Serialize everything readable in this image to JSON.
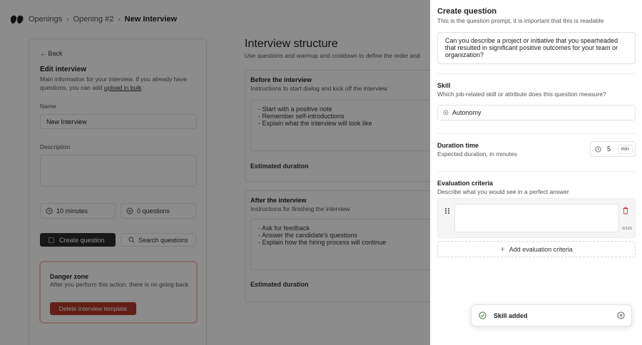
{
  "breadcrumb": [
    "Openings",
    "Opening #2",
    "New Interview"
  ],
  "edit": {
    "back_label": "Back",
    "title": "Edit interview",
    "desc_prefix": "Main information for your interview. If you already have questions, you can add ",
    "desc_link": "upload in bulk",
    "desc_suffix": ".",
    "name_label": "Name",
    "name_value": "New Interview",
    "description_label": "Description",
    "description_value": "",
    "duration_stat": "10 minutes",
    "questions_stat": "0 questions",
    "create_question": "Create question",
    "search_questions": "Search questions",
    "danger_title": "Danger zone",
    "danger_desc": "After you perform this action, there is no going back",
    "delete_template": "Delete interview template"
  },
  "structure": {
    "title": "Interview structure",
    "subtitle": "Use questions and warmup and cooldown to define the order and",
    "before": {
      "title": "Before the interview",
      "subtitle": "Instructions to start dialog and kick off the interview",
      "lines": [
        "- Start with a positive note",
        "- Remember self-introductions",
        "- Explain what the interview will look like"
      ],
      "estimated": "Estimated duration"
    },
    "after": {
      "title": "After the interview",
      "subtitle": "Instructions for finishing the interview",
      "lines": [
        "- Ask for feedback",
        "- Answer the candidate's questions",
        "- Explain how the hiring process will continue"
      ],
      "estimated": "Estimated duration"
    }
  },
  "drawer": {
    "title": "Create question",
    "subtitle": "This is the question prompt, it is important that this is readable",
    "question_text": "Can you describe a project or initiative that you spearheaded that resulted in significant positive outcomes for your team or organization?",
    "skill_label": "Skill",
    "skill_help": "Which job-related skill or attribute does this question measure?",
    "skill_value": "Autonomy",
    "duration_label": "Duration time",
    "duration_help": "Expected duration, in minutes",
    "duration_value": "5",
    "duration_unit": "min",
    "criteria_label": "Evaluation criteria",
    "criteria_help": "Describe what you would see in a perfect answer",
    "criteria_counter": "0/120",
    "add_criteria": "Add evaluation criteria"
  },
  "toast": {
    "message": "Skill added"
  }
}
